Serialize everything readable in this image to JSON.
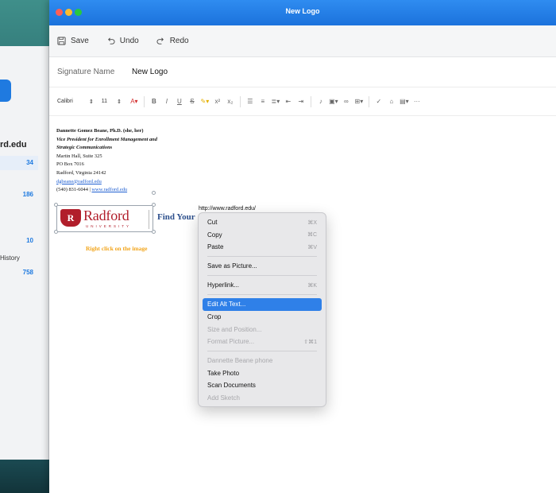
{
  "window": {
    "title": "New Logo"
  },
  "toolbar": {
    "save": "Save",
    "undo": "Undo",
    "redo": "Redo"
  },
  "signature": {
    "label": "Signature Name",
    "value": "New Logo"
  },
  "format": {
    "font": "Calibri",
    "size": "11"
  },
  "background_window": {
    "domain": "rd.edu",
    "counts": [
      "34",
      "186",
      "10",
      "758"
    ],
    "history": "History"
  },
  "sig_body": {
    "name": "Dannette Gomez Beane, Ph.D. (she, her)",
    "title1": "Vice President for Enrollment Management and",
    "title2": "Strategic Communications",
    "address1": "Martin Hall, Suite 325",
    "address2": "PO Box 7016",
    "address3": "Radford, Virginia 24142",
    "email": "dgbeane@radford.edu",
    "phone": "(540) 831-6044 | ",
    "website": "www.radford.edu"
  },
  "logo": {
    "emblem": "R",
    "word": "Radford",
    "sub": "UNIVERSITY",
    "tagline": "Find Your"
  },
  "note": "Right click on the image",
  "tooltip": "http://www.radford.edu/",
  "menu": {
    "items": [
      {
        "label": "Cut",
        "shortcut": "⌘X",
        "disabled": false
      },
      {
        "label": "Copy",
        "shortcut": "⌘C",
        "disabled": false
      },
      {
        "label": "Paste",
        "shortcut": "⌘V",
        "disabled": false
      },
      {
        "label": "Save as Picture...",
        "shortcut": "",
        "disabled": false
      },
      {
        "label": "Hyperlink...",
        "shortcut": "⌘K",
        "disabled": false
      },
      {
        "label": "Edit Alt Text...",
        "shortcut": "",
        "disabled": false
      },
      {
        "label": "Crop",
        "shortcut": "",
        "disabled": false
      },
      {
        "label": "Size and Position...",
        "shortcut": "",
        "disabled": true
      },
      {
        "label": "Format Picture...",
        "shortcut": "⇧⌘1",
        "disabled": true
      },
      {
        "label": "Dannette Beane phone",
        "shortcut": "",
        "disabled": true
      },
      {
        "label": "Take Photo",
        "shortcut": "",
        "disabled": false
      },
      {
        "label": "Scan Documents",
        "shortcut": "",
        "disabled": false
      },
      {
        "label": "Add Sketch",
        "shortcut": "",
        "disabled": true
      }
    ]
  },
  "colors": {
    "titlebar": "#1b72dc",
    "highlight": "#2f80e8",
    "brand": "#b11e2b"
  }
}
